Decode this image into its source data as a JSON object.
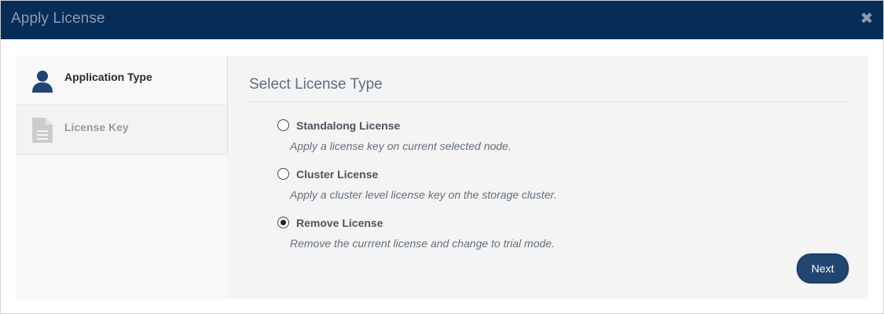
{
  "dialog": {
    "title": "Apply License",
    "close_icon": "close-icon"
  },
  "sidebar": {
    "items": [
      {
        "label": "Application Type",
        "icon": "user-icon",
        "active": true
      },
      {
        "label": "License Key",
        "icon": "document-icon",
        "active": false
      }
    ]
  },
  "main": {
    "title": "Select License Type",
    "options": [
      {
        "label": "Standalong License",
        "description": "Apply a license key on current selected node.",
        "selected": false
      },
      {
        "label": "Cluster License",
        "description": "Apply a cluster level license key on the storage cluster.",
        "selected": false
      },
      {
        "label": "Remove License",
        "description": "Remove the currrent license and change to trial mode.",
        "selected": true
      }
    ],
    "next_label": "Next"
  },
  "colors": {
    "titlebar": "#052d58",
    "accent_button": "#1f4570",
    "active_icon": "#1f4570",
    "inactive_icon": "#c8c8c8"
  }
}
